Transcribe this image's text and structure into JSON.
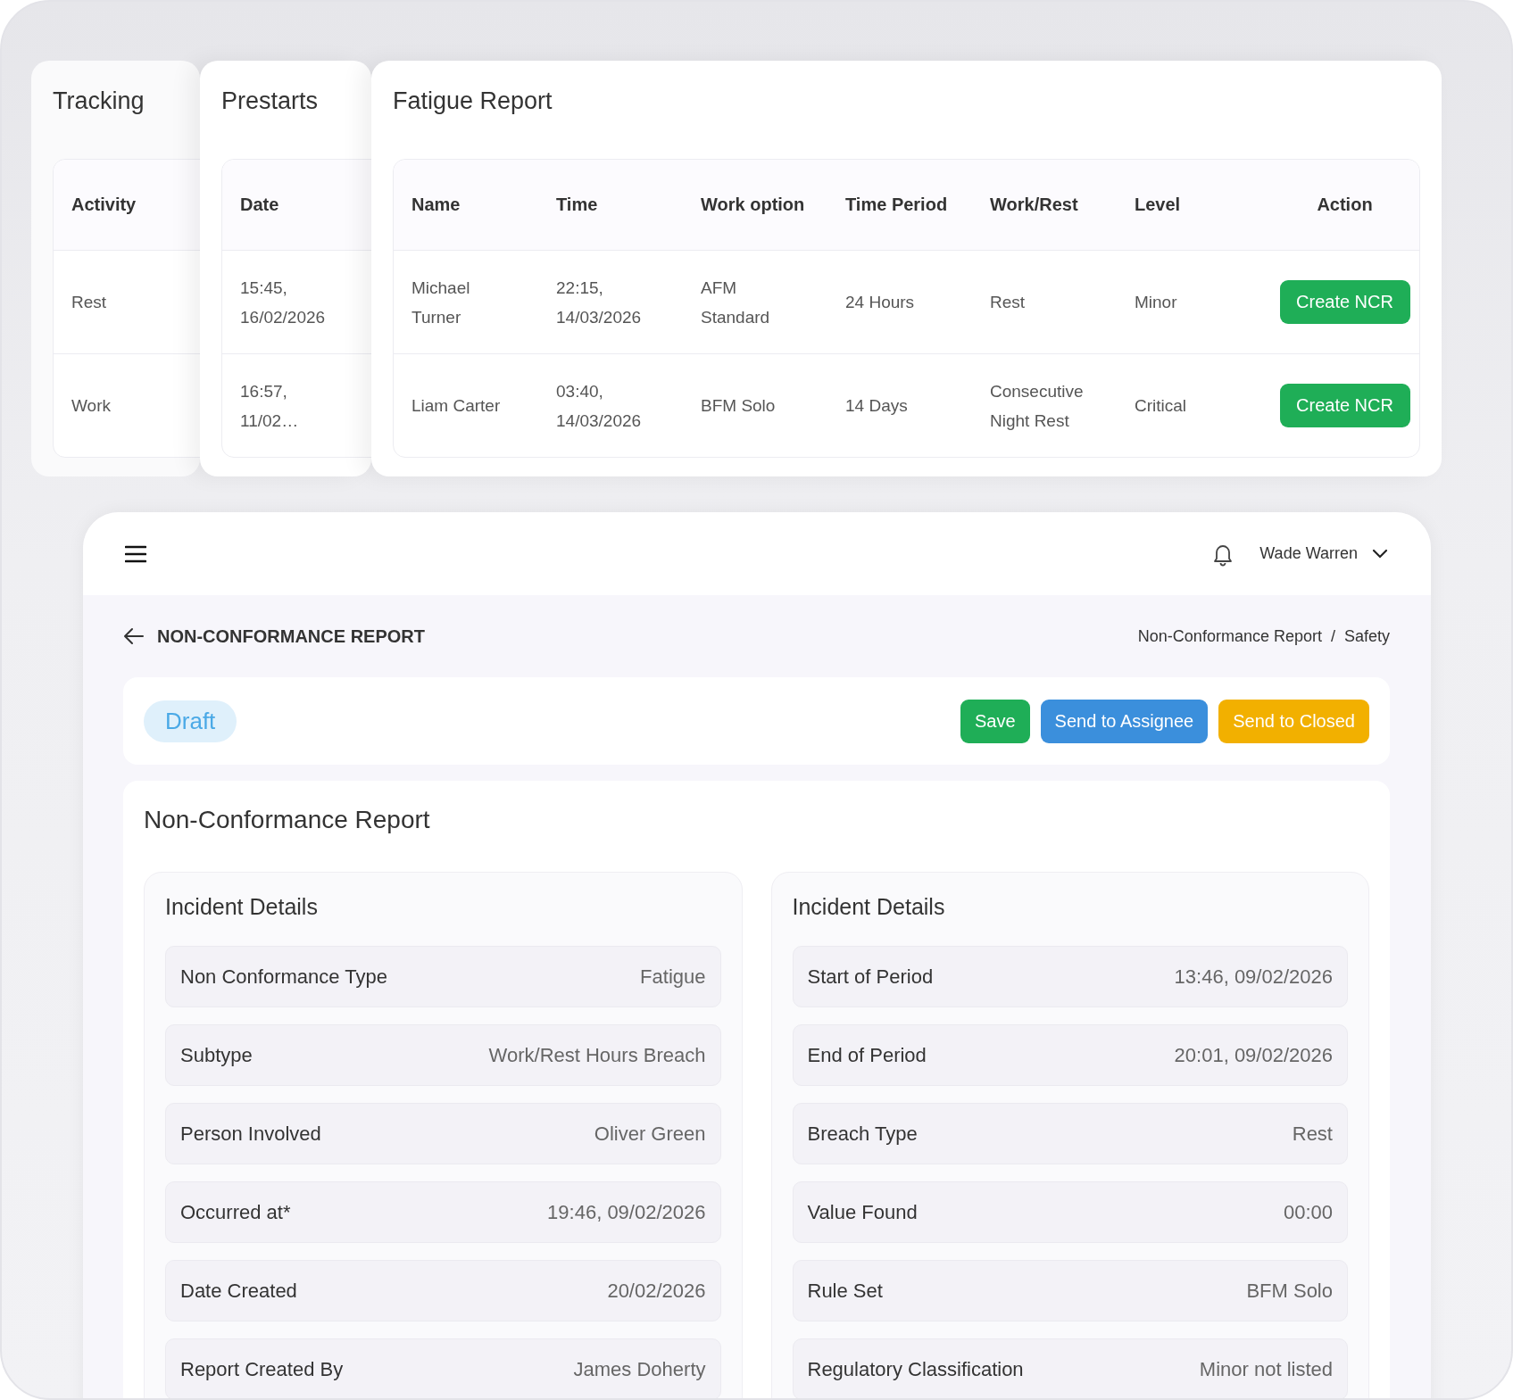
{
  "cards": [
    {
      "title": "Tracking",
      "columns": [
        "Activity"
      ],
      "rows": [
        {
          "cells": [
            "Rest"
          ]
        },
        {
          "cells": [
            "Work"
          ]
        }
      ]
    },
    {
      "title": "Prestarts",
      "columns": [
        "Date"
      ],
      "rows": [
        {
          "cells": [
            "15:45, 16/02/2026"
          ]
        },
        {
          "cells": [
            "16:57, 11/02…"
          ]
        }
      ]
    },
    {
      "title": "Fatigue Report",
      "columns": [
        "Name",
        "Time",
        "Work option",
        "Time Period",
        "Work/Rest",
        "Level",
        "Action"
      ],
      "rows": [
        {
          "cells": [
            "Michael Turner",
            "22:15, 14/03/2026",
            "AFM Standard",
            "24 Hours",
            "Rest",
            "Minor"
          ],
          "action": "Create NCR"
        },
        {
          "cells": [
            "Liam Carter",
            "03:40, 14/03/2026",
            "BFM Solo",
            "14 Days",
            "Consecutive Night Rest",
            "Critical"
          ],
          "action": "Create NCR"
        }
      ]
    }
  ],
  "topbar": {
    "user": "Wade Warren"
  },
  "page": {
    "title": "NON-CONFORMANCE REPORT",
    "breadcrumb": {
      "items": [
        "Non-Conformance Report",
        "Safety"
      ],
      "separator": "/"
    }
  },
  "status": "Draft",
  "actions": [
    {
      "label": "Save",
      "kind": "save"
    },
    {
      "label": "Send to Assignee",
      "kind": "assign"
    },
    {
      "label": "Send to Closed",
      "kind": "close"
    }
  ],
  "report": {
    "title": "Non-Conformance Report",
    "panels": [
      {
        "title": "Incident Details",
        "fields": [
          {
            "label": "Non Conformance Type",
            "value": "Fatigue"
          },
          {
            "label": "Subtype",
            "value": "Work/Rest Hours Breach"
          },
          {
            "label": "Person Involved",
            "value": "Oliver Green"
          },
          {
            "label": "Occurred at*",
            "value": "19:46, 09/02/2026"
          },
          {
            "label": "Date Created",
            "value": "20/02/2026"
          },
          {
            "label": "Report Created By",
            "value": "James Doherty"
          }
        ]
      },
      {
        "title": "Incident Details",
        "fields": [
          {
            "label": "Start of Period",
            "value": "13:46, 09/02/2026"
          },
          {
            "label": "End of Period",
            "value": "20:01, 09/02/2026"
          },
          {
            "label": "Breach Type",
            "value": "Rest"
          },
          {
            "label": "Value Found",
            "value": "00:00"
          },
          {
            "label": "Rule Set",
            "value": "BFM Solo"
          },
          {
            "label": "Regulatory Classification",
            "value": "Minor not listed"
          }
        ]
      }
    ]
  }
}
